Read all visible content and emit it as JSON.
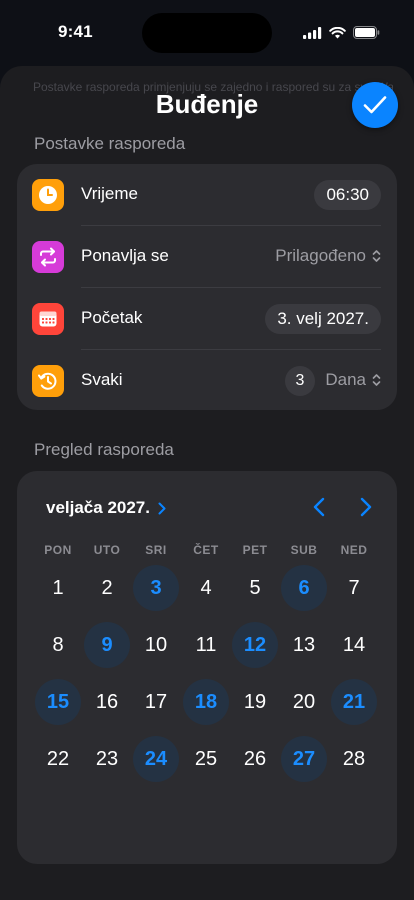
{
  "status": {
    "time": "9:41"
  },
  "background_text": "Postavke rasporeda primjenjuju se zajedno i raspored su za sve Wake Up",
  "header": {
    "title": "Buđenje"
  },
  "schedule_settings": {
    "section_label": "Postavke rasporeda",
    "rows": [
      {
        "label": "Vrijeme",
        "value": "06:30",
        "icon": "clock-icon",
        "color": "#ff9f0a"
      },
      {
        "label": "Ponavlja se",
        "value": "Prilagođeno",
        "icon": "repeat-icon",
        "color": "#d63bd8"
      },
      {
        "label": "Početak",
        "value": "3. velj 2027.",
        "icon": "calendar-icon",
        "color": "#ff453a"
      },
      {
        "label": "Svaki",
        "count": "3",
        "unit": "Dana",
        "icon": "history-icon",
        "color": "#ff9f0a"
      }
    ]
  },
  "calendar": {
    "section_label": "Pregled rasporeda",
    "month": "veljača 2027.",
    "weekdays": [
      "PON",
      "UTO",
      "SRI",
      "ČET",
      "PET",
      "SUB",
      "NED"
    ],
    "weeks": [
      [
        "1",
        "2",
        "3",
        "4",
        "5",
        "6",
        "7"
      ],
      [
        "8",
        "9",
        "10",
        "11",
        "12",
        "13",
        "14"
      ],
      [
        "15",
        "16",
        "17",
        "18",
        "19",
        "20",
        "21"
      ],
      [
        "22",
        "23",
        "24",
        "25",
        "26",
        "27",
        "28"
      ]
    ],
    "selected_days": [
      "3",
      "6",
      "9",
      "12",
      "15",
      "18",
      "21",
      "24",
      "27"
    ]
  },
  "colors": {
    "accent": "#0a84ff",
    "selected_day_bg": "#243243",
    "card_bg": "#2c2c30",
    "sheet_bg": "#1d1d20"
  }
}
